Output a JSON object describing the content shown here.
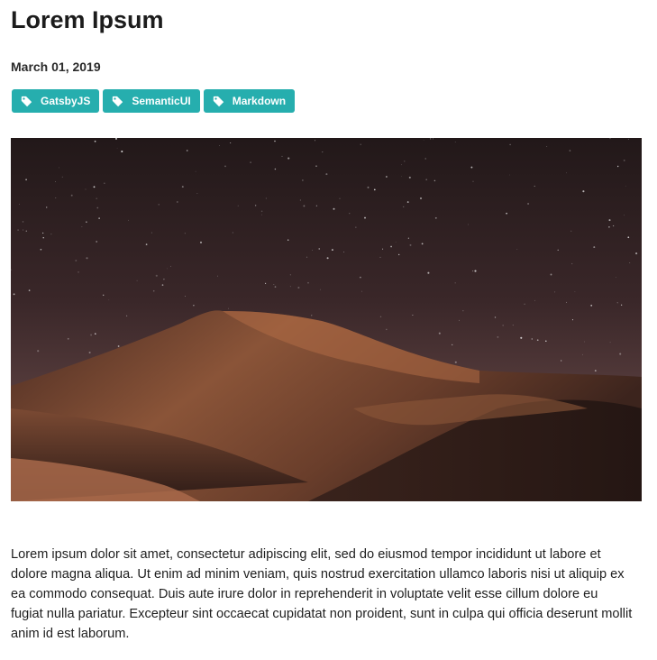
{
  "post": {
    "title": "Lorem Ipsum",
    "date": "March 01, 2019",
    "tags": [
      {
        "label": "GatsbyJS",
        "icon": "tag-icon"
      },
      {
        "label": "SemanticUI",
        "icon": "tag-icon"
      },
      {
        "label": "Markdown",
        "icon": "tag-icon"
      }
    ],
    "body": "Lorem ipsum dolor sit amet, consectetur adipiscing elit, sed do eiusmod tempor incididunt ut labore et dolore magna aliqua. Ut enim ad minim veniam, quis nostrud exercitation ullamco laboris nisi ut aliquip ex ea commodo consequat. Duis aute irure dolor in reprehenderit in voluptate velit esse cillum dolore eu fugiat nulla pariatur. Excepteur sint occaecat cupidatat non proident, sunt in culpa qui officia deserunt mollit anim id est laborum."
  },
  "colors": {
    "tag_background": "#26aeae",
    "tag_text": "#ffffff",
    "title": "#1c1c1c"
  }
}
